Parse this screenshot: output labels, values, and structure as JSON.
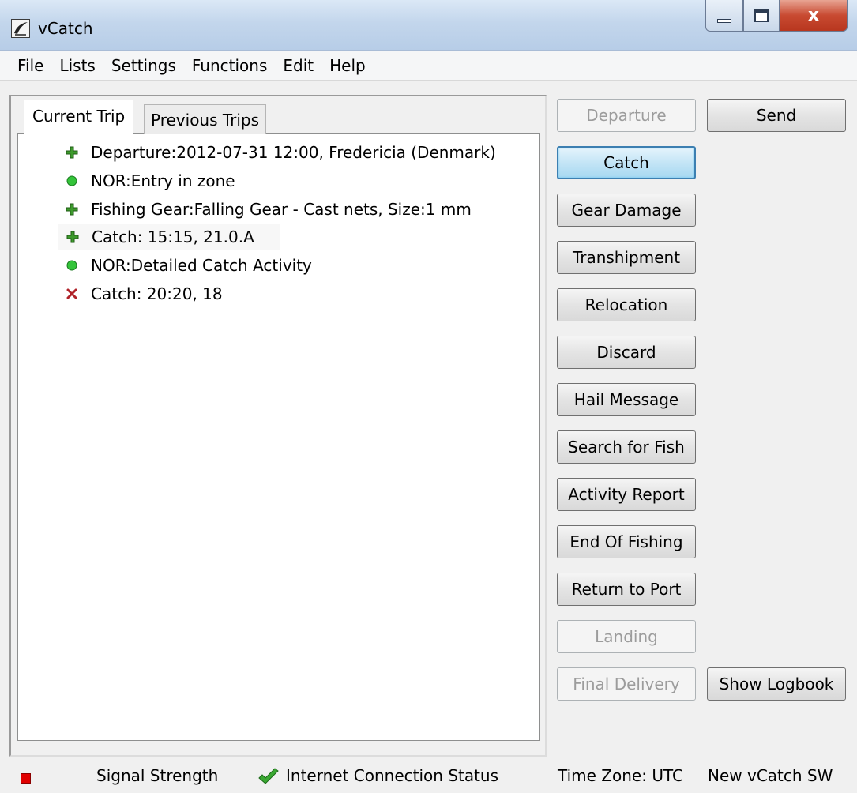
{
  "window": {
    "title": "vCatch",
    "close_glyph": "x"
  },
  "menu": [
    "File",
    "Lists",
    "Settings",
    "Functions",
    "Edit",
    "Help"
  ],
  "tabs": {
    "current": "Current Trip",
    "previous": "Previous Trips"
  },
  "trip_items": [
    {
      "icon": "green-plus-icon",
      "text": "Departure:2012-07-31 12:00,  Fredericia (Denmark)"
    },
    {
      "icon": "green-circle-icon",
      "text": "NOR:Entry in zone"
    },
    {
      "icon": "green-plus-icon",
      "text": "Fishing Gear:Falling Gear - Cast nets, Size:1 mm"
    },
    {
      "icon": "green-plus-icon",
      "text": "Catch: 15:15, 21.0.A",
      "selected": true
    },
    {
      "icon": "green-circle-icon",
      "text": "NOR:Detailed Catch Activity"
    },
    {
      "icon": "red-x-icon",
      "text": "Catch: 20:20, 18"
    }
  ],
  "buttons": {
    "departure": "Departure",
    "send": "Send",
    "catch": "Catch",
    "gear_damage": "Gear Damage",
    "transhipment": "Transhipment",
    "relocation": "Relocation",
    "discard": "Discard",
    "hail_message": "Hail Message",
    "search_for_fish": "Search for Fish",
    "activity_report": "Activity Report",
    "end_of_fishing": "End Of Fishing",
    "return_to_port": "Return to Port",
    "landing": "Landing",
    "final_delivery": "Final Delivery",
    "show_logbook": "Show Logbook"
  },
  "status": {
    "signal_strength": "Signal Strength",
    "internet_status": "Internet Connection Status",
    "time_zone": "Time Zone: UTC",
    "version": "New vCatch SW"
  },
  "colors": {
    "signal_indicator": "#e00000",
    "internet_check": "#3aa832",
    "focus_border": "#3c7fb1"
  }
}
